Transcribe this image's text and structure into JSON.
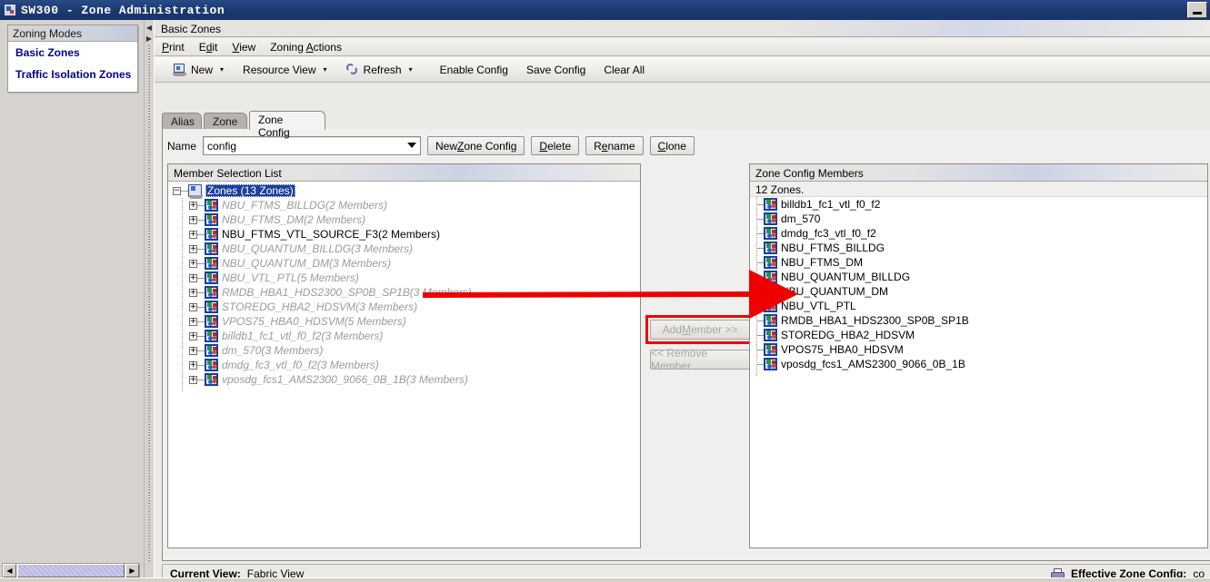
{
  "window": {
    "title": "SW300 - Zone Administration",
    "icon": "app-icon",
    "minimize_label": "_"
  },
  "sidebar": {
    "header": "Zoning Modes",
    "items": [
      {
        "label": "Basic Zones"
      },
      {
        "label": "Traffic Isolation Zones"
      }
    ]
  },
  "panel": {
    "title": "Basic Zones"
  },
  "menubar": {
    "items": [
      {
        "pre": "P",
        "mnemonic": "",
        "label": "Print",
        "m_index": 0
      },
      {
        "label": "Edit",
        "m_index": 1
      },
      {
        "label": "View",
        "m_index": 1
      },
      {
        "label": "Zoning Actions",
        "m_index": 7
      }
    ],
    "print": "Print",
    "edit": "Edit",
    "view": "View",
    "zoning_actions": "Zoning Actions"
  },
  "toolbar": {
    "new_label": "New",
    "resource_view_label": "Resource View",
    "refresh_label": "Refresh",
    "enable_config_label": "Enable Config",
    "save_config_label": "Save Config",
    "clear_all_label": "Clear All",
    "caret": "▾"
  },
  "tabs": [
    {
      "label": "Alias",
      "active": false
    },
    {
      "label": "Zone",
      "active": false
    },
    {
      "label": "Zone Config",
      "active": true
    }
  ],
  "name_row": {
    "label": "Name",
    "value": "config",
    "new_zone_config": "New Zone Config",
    "delete": "Delete",
    "rename": "Rename",
    "clone": "Clone"
  },
  "member_selection": {
    "header": "Member Selection List",
    "root": {
      "label": "Zones (13 Zones)",
      "selected": true,
      "toggle": "−"
    },
    "children": [
      {
        "label": "NBU_FTMS_BILLDG(2 Members)",
        "dim": true
      },
      {
        "label": "NBU_FTMS_DM(2 Members)",
        "dim": true
      },
      {
        "label": "NBU_FTMS_VTL_SOURCE_F3(2 Members)",
        "dim": false
      },
      {
        "label": "NBU_QUANTUM_BILLDG(3 Members)",
        "dim": true
      },
      {
        "label": "NBU_QUANTUM_DM(3 Members)",
        "dim": true
      },
      {
        "label": "NBU_VTL_PTL(5 Members)",
        "dim": true
      },
      {
        "label": "RMDB_HBA1_HDS2300_SP0B_SP1B(3 Members)",
        "dim": true
      },
      {
        "label": "STOREDG_HBA2_HDSVM(3 Members)",
        "dim": true
      },
      {
        "label": "VPOS75_HBA0_HDSVM(5 Members)",
        "dim": true
      },
      {
        "label": "billdb1_fc1_vtl_f0_f2(3 Members)",
        "dim": true
      },
      {
        "label": "dm_570(3 Members)",
        "dim": true
      },
      {
        "label": "dmdg_fc3_vtl_f0_f2(3 Members)",
        "dim": true
      },
      {
        "label": "vposdg_fcs1_AMS2300_9066_0B_1B(3 Members)",
        "dim": true
      }
    ],
    "child_toggle": "+"
  },
  "transfer_buttons": {
    "add_member": "Add Member >>",
    "remove_member": "<< Remove Member",
    "add_member_enabled": false,
    "remove_member_enabled": false,
    "highlight_color": "#ee0000"
  },
  "zone_config_members": {
    "header": "Zone Config Members",
    "count_text": "12 Zones.",
    "items": [
      {
        "label": "billdb1_fc1_vtl_f0_f2"
      },
      {
        "label": "dm_570"
      },
      {
        "label": "dmdg_fc3_vtl_f0_f2"
      },
      {
        "label": "NBU_FTMS_BILLDG"
      },
      {
        "label": "NBU_FTMS_DM"
      },
      {
        "label": "NBU_QUANTUM_BILLDG"
      },
      {
        "label": "NBU_QUANTUM_DM"
      },
      {
        "label": "NBU_VTL_PTL"
      },
      {
        "label": "RMDB_HBA1_HDS2300_SP0B_SP1B"
      },
      {
        "label": "STOREDG_HBA2_HDSVM"
      },
      {
        "label": "VPOS75_HBA0_HDSVM"
      },
      {
        "label": "vposdg_fcs1_AMS2300_9066_0B_1B"
      }
    ]
  },
  "statusbar": {
    "current_view_label": "Current View:",
    "current_view_value": "Fabric View",
    "effective_zone_config_label": "Effective Zone Config:",
    "effective_zone_config_value": "co"
  },
  "annotation": {
    "arrow_color": "#ee0000",
    "arrow_target": "NBU_VTL_PTL"
  }
}
